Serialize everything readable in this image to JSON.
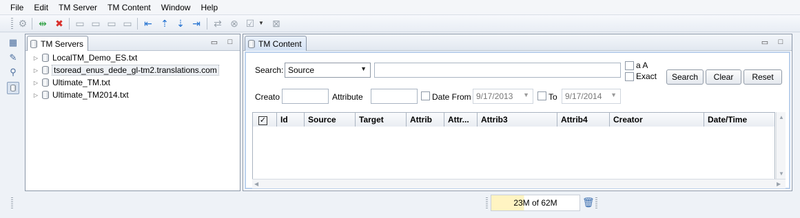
{
  "menu": [
    "File",
    "Edit",
    "TM Server",
    "TM Content",
    "Window",
    "Help"
  ],
  "tm_servers": {
    "tab_label": "TM Servers",
    "items": [
      "LocalTM_Demo_ES.txt",
      "tsoread_enus_dede_gl-tm2.translations.com",
      "Ultimate_TM.txt",
      "Ultimate_TM2014.txt"
    ]
  },
  "tm_content": {
    "tab_label": "TM Content",
    "search_label": "Search:",
    "search_field_selected": "Source",
    "search_text": "",
    "case_option": "a A",
    "exact_option": "Exact",
    "search_button": "Search",
    "clear_button": "Clear",
    "reset_button": "Reset",
    "creator_label": "Creato",
    "attribute_label": "Attribute",
    "date_from_label": "Date From",
    "date_from_value": "9/17/2013",
    "to_label": "To",
    "date_to_value": "9/17/2014",
    "columns": [
      "Id",
      "Source",
      "Target",
      "Attrib",
      "Attr...",
      "Attrib3",
      "Attrib4",
      "Creator",
      "Date/Time"
    ],
    "header_checked": true
  },
  "status": {
    "memory": "23M of 62M",
    "memory_used_fraction": 0.37
  },
  "colors": {
    "accent_border": "#bcd1ec",
    "window_bg": "#eef2f7"
  }
}
